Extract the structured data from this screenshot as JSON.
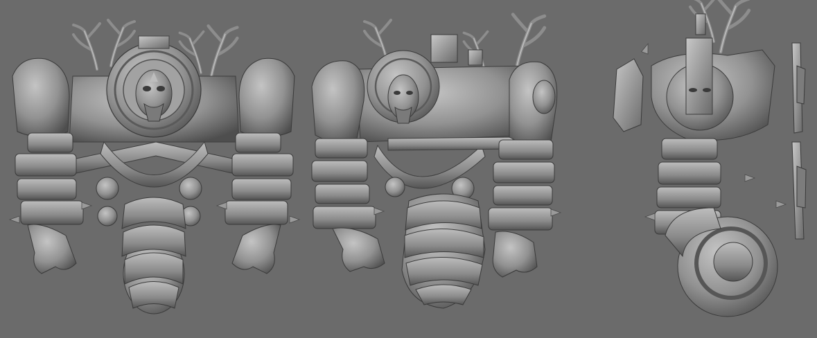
{
  "scene": {
    "background": "#6b6b6b",
    "material_light": "#b4b4b4",
    "material_mid": "#8c8c8c",
    "material_dark": "#4a4a4a",
    "views": [
      {
        "name": "front-view",
        "label": ""
      },
      {
        "name": "three-quarter-view",
        "label": ""
      },
      {
        "name": "side-view",
        "label": ""
      }
    ]
  }
}
